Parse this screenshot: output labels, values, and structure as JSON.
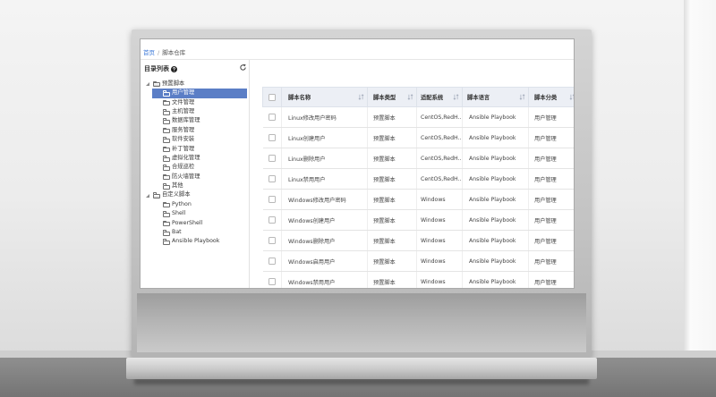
{
  "colors": {
    "accent": "#5b7ec6",
    "link": "#3b78d8",
    "header_bg": "#eceff5"
  },
  "breadcrumb": {
    "home": "首页",
    "separator": "/",
    "current": "脚本仓库"
  },
  "sidebar": {
    "title": "目录列表",
    "help_icon": "help-icon",
    "refresh_icon": "refresh-icon",
    "tree": [
      {
        "label": "预置脚本",
        "expanded": true,
        "icon": "folder-open-icon",
        "children": [
          {
            "label": "用户管理",
            "selected": true,
            "icon": "folder-icon"
          },
          {
            "label": "文件管理",
            "icon": "folder-icon"
          },
          {
            "label": "主机管理",
            "icon": "folder-icon"
          },
          {
            "label": "数据库管理",
            "icon": "folder-icon"
          },
          {
            "label": "服务管理",
            "icon": "folder-icon"
          },
          {
            "label": "软件安装",
            "icon": "folder-icon"
          },
          {
            "label": "补丁管理",
            "icon": "folder-icon"
          },
          {
            "label": "虚拟化管理",
            "icon": "folder-icon"
          },
          {
            "label": "合规巡检",
            "icon": "folder-icon"
          },
          {
            "label": "防火墙管理",
            "icon": "folder-icon"
          },
          {
            "label": "其他",
            "icon": "folder-icon"
          }
        ]
      },
      {
        "label": "自定义脚本",
        "expanded": true,
        "icon": "folder-open-icon",
        "children": [
          {
            "label": "Python",
            "icon": "folder-icon"
          },
          {
            "label": "Shell",
            "icon": "folder-icon"
          },
          {
            "label": "PowerShell",
            "icon": "folder-icon"
          },
          {
            "label": "Bat",
            "icon": "folder-icon"
          },
          {
            "label": "Ansible Playbook",
            "icon": "folder-icon"
          }
        ]
      }
    ]
  },
  "table": {
    "sort_icon": "sort-icon",
    "columns": {
      "name": "脚本名称",
      "type": "脚本类型",
      "os": "适配系统",
      "language": "脚本语言",
      "category": "脚本分类"
    },
    "rows": [
      {
        "name": "Linux修改用户密码",
        "type": "预置脚本",
        "os": "CentOS,RedH...",
        "language": "Ansible Playbook",
        "category": "用户管理"
      },
      {
        "name": "Linux创建用户",
        "type": "预置脚本",
        "os": "CentOS,RedH...",
        "language": "Ansible Playbook",
        "category": "用户管理"
      },
      {
        "name": "Linux删除用户",
        "type": "预置脚本",
        "os": "CentOS,RedH...",
        "language": "Ansible Playbook",
        "category": "用户管理"
      },
      {
        "name": "Linux禁用用户",
        "type": "预置脚本",
        "os": "CentOS,RedH...",
        "language": "Ansible Playbook",
        "category": "用户管理"
      },
      {
        "name": "Windows修改用户密码",
        "type": "预置脚本",
        "os": "Windows",
        "language": "Ansible Playbook",
        "category": "用户管理"
      },
      {
        "name": "Windows创建用户",
        "type": "预置脚本",
        "os": "Windows",
        "language": "Ansible Playbook",
        "category": "用户管理"
      },
      {
        "name": "Windows删除用户",
        "type": "预置脚本",
        "os": "Windows",
        "language": "Ansible Playbook",
        "category": "用户管理"
      },
      {
        "name": "Windows启用用户",
        "type": "预置脚本",
        "os": "Windows",
        "language": "Ansible Playbook",
        "category": "用户管理"
      },
      {
        "name": "Windows禁用用户",
        "type": "预置脚本",
        "os": "Windows",
        "language": "Ansible Playbook",
        "category": "用户管理"
      }
    ]
  }
}
